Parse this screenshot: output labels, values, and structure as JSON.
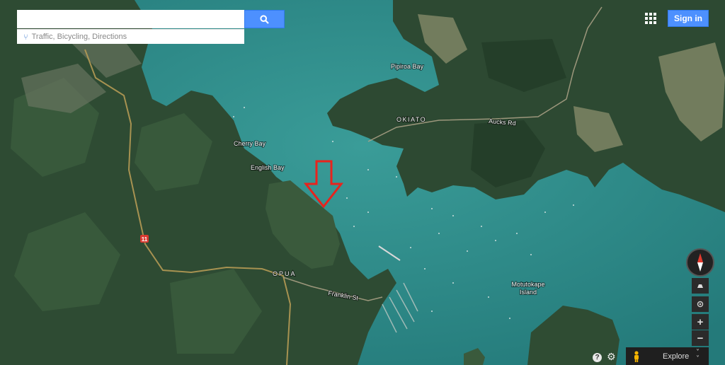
{
  "search": {
    "value": "",
    "placeholder": "",
    "suggestion": "Traffic, Bicycling, Directions"
  },
  "header": {
    "signin_label": "Sign in"
  },
  "map": {
    "type": "satellite",
    "labels": {
      "pipiroa_bay": "Pipiroa Bay",
      "okiato": "OKIATO",
      "aucks_rd": "Aucks Rd",
      "cherry_bay": "Cherry Bay",
      "english_bay": "English Bay",
      "opua": "OPUA",
      "franklin_st": "Franklin St",
      "motutokape_1": "Motutokape",
      "motutokape_2": "Island",
      "route_shield": "11"
    },
    "annotation": "red-down-arrow",
    "colors": {
      "water": "#2f8b8a",
      "land": "#2d4a34",
      "arrow": "#e8231d",
      "accent": "#4d90fe"
    }
  },
  "controls": {
    "zoom_in": "+",
    "zoom_out": "−",
    "help": "?",
    "explore_label": "Explore"
  }
}
